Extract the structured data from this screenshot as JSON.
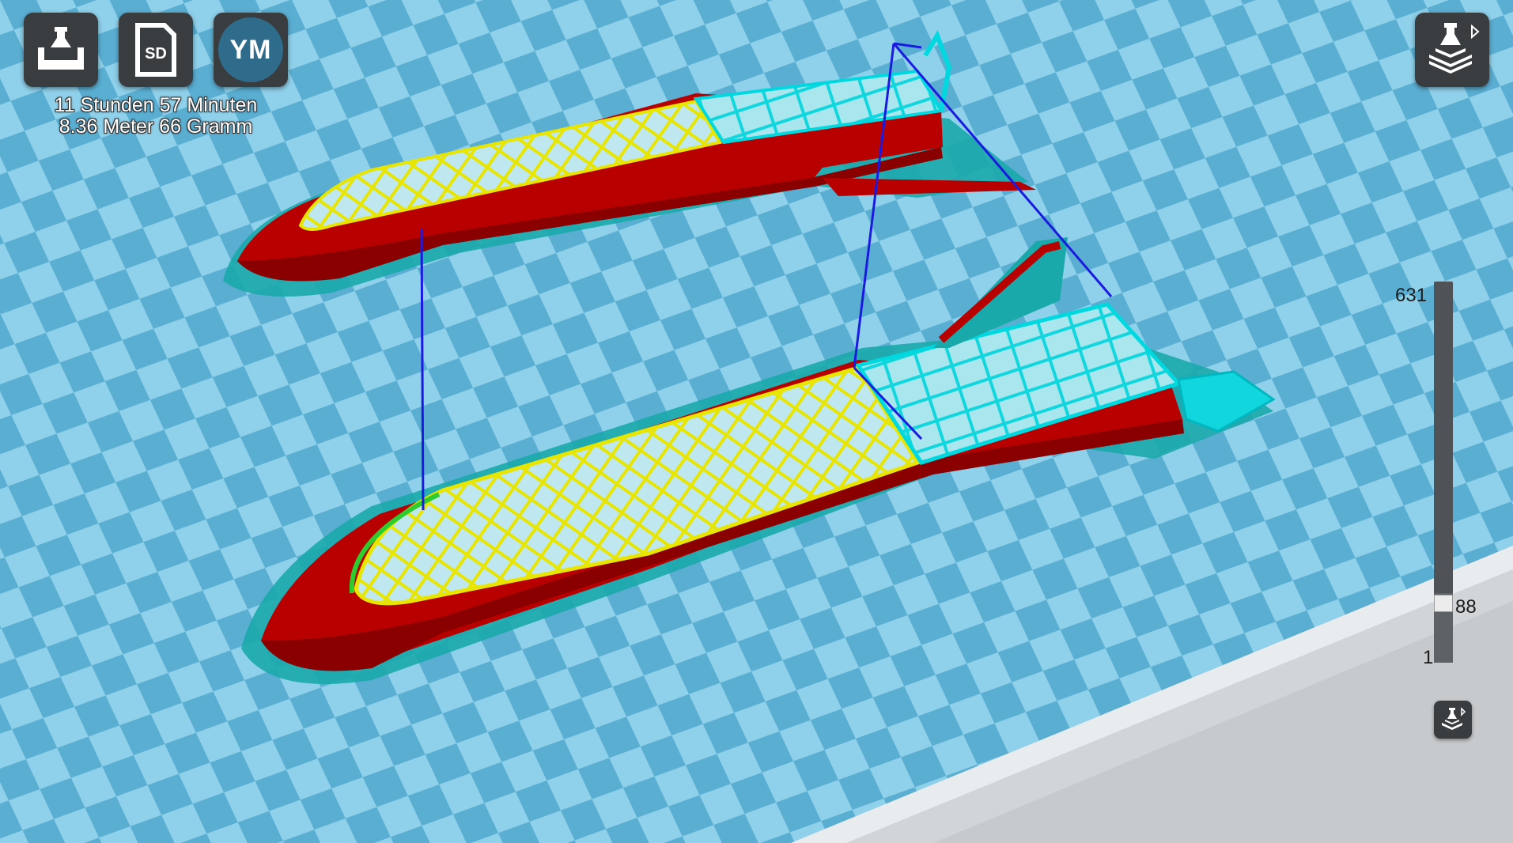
{
  "toolbar": {
    "slice_icon": "print-head-tray-icon",
    "sd_label": "SD",
    "user_initials": "YM"
  },
  "print_info": {
    "duration": "11 Stunden 57 Minuten",
    "material": "8.36 Meter 66 Gramm"
  },
  "view_mode_icon": "layer-view-icon",
  "layer_slider": {
    "max": "631",
    "current": "88",
    "min": "1"
  },
  "colors": {
    "build_plate_light": "#8fd0ea",
    "build_plate_dark": "#5aaed2",
    "wall_outer": "#c80000",
    "infill": "#e8e600",
    "support": "#00d8e0",
    "travel": "#1a1ae0",
    "skin": "#2ecc2e"
  }
}
